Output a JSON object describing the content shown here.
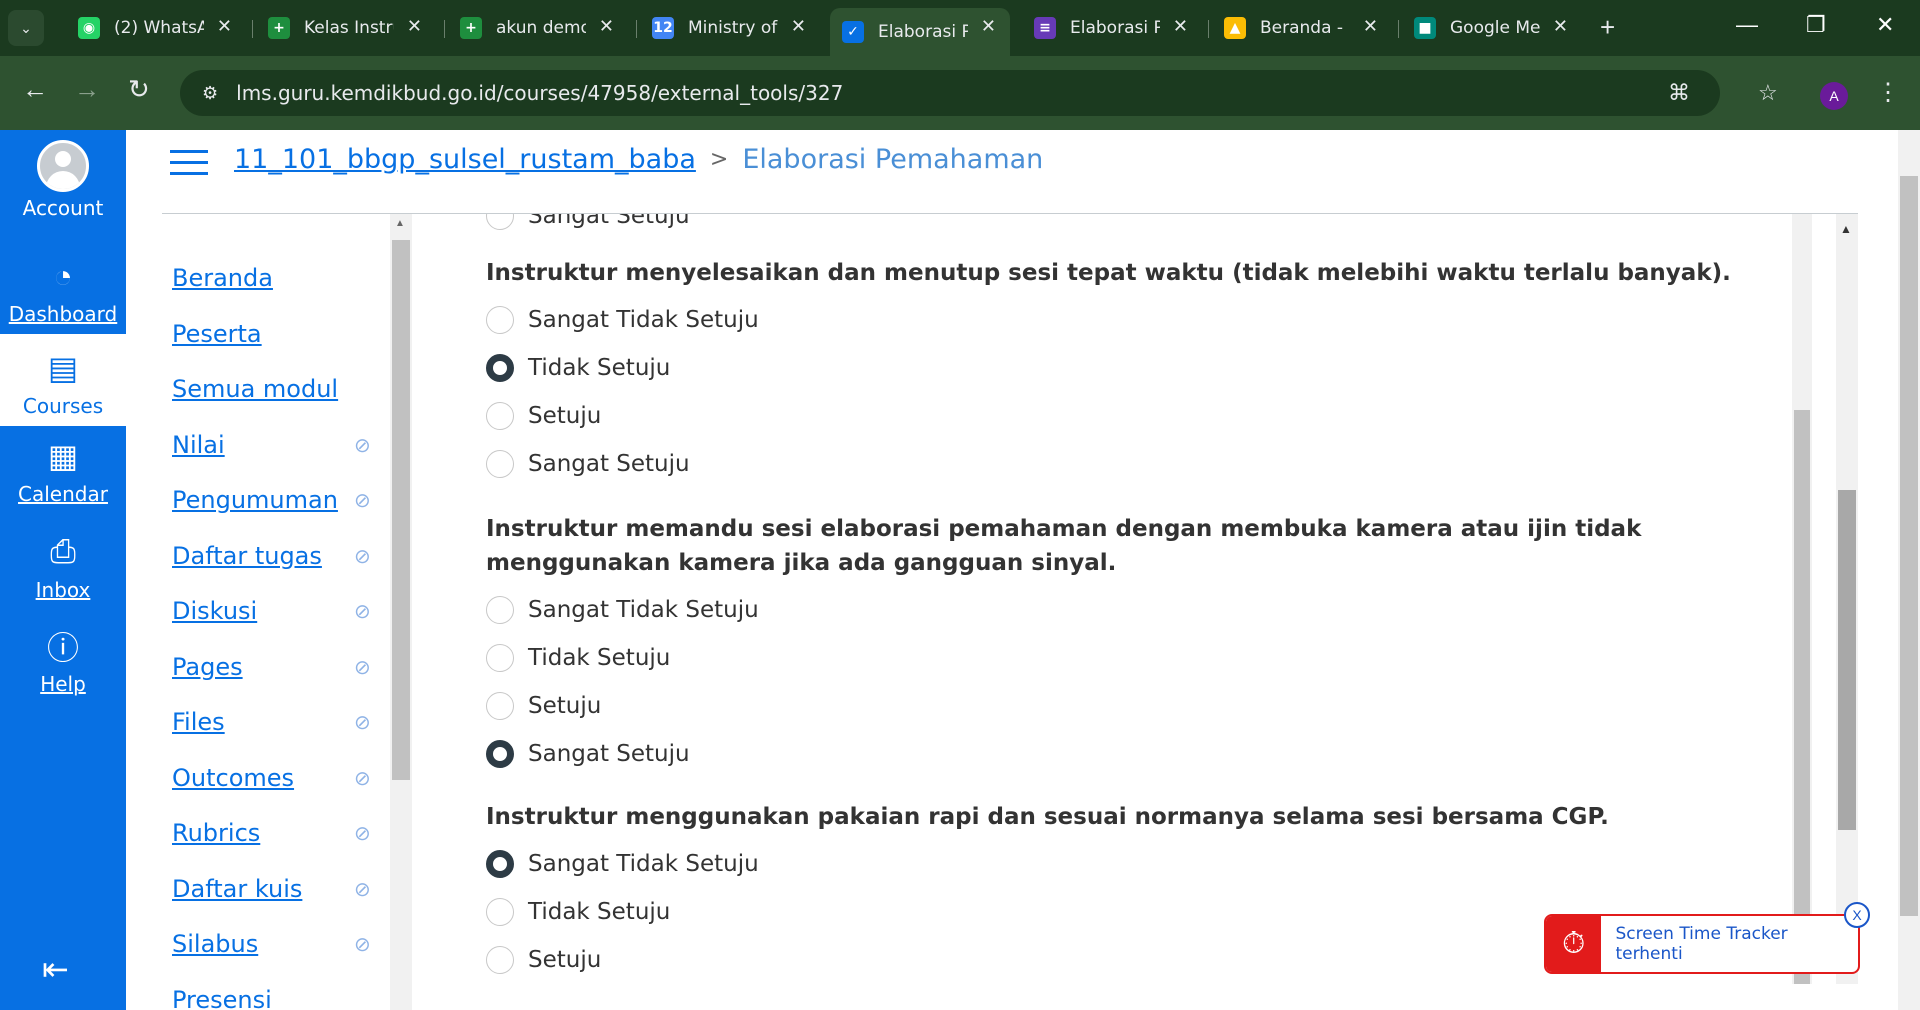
{
  "browser": {
    "tabs": [
      {
        "label": "(2) WhatsA",
        "icon": "whatsapp-icon",
        "color": "#25d366",
        "glyph": "◉"
      },
      {
        "label": "Kelas Instru",
        "icon": "sheets-icon",
        "color": "#1e8e3e",
        "glyph": "+"
      },
      {
        "label": "akun demo",
        "icon": "sheets-icon",
        "color": "#1e8e3e",
        "glyph": "+"
      },
      {
        "label": "Ministry of",
        "icon": "calendar-icon",
        "color": "#4285f4",
        "glyph": "12"
      },
      {
        "label": "Elaborasi P",
        "icon": "canvas-icon",
        "color": "#0770e3",
        "glyph": "✓"
      },
      {
        "label": "Elaborasi P",
        "icon": "forms-icon",
        "color": "#673ab7",
        "glyph": "≡"
      },
      {
        "label": "Beranda -",
        "icon": "drive-icon",
        "color": "#fbbc04",
        "glyph": "▲"
      },
      {
        "label": "Google Me",
        "icon": "meet-icon",
        "color": "#00897b",
        "glyph": "■"
      }
    ],
    "url": "lms.guru.kemdikbud.go.id/courses/47958/external_tools/327",
    "profile_initial": "A"
  },
  "globalnav": {
    "account": "Account",
    "dashboard": "Dashboard",
    "courses": "Courses",
    "calendar": "Calendar",
    "inbox": "Inbox",
    "help": "Help"
  },
  "breadcrumb": {
    "course": "11_101_bbgp_sulsel_rustam_baba",
    "page": "Elaborasi Pemahaman",
    "separator": ">"
  },
  "coursenav": {
    "items": [
      {
        "label": "Beranda",
        "hidden": false
      },
      {
        "label": "Peserta",
        "hidden": false
      },
      {
        "label": "Semua modul",
        "hidden": false
      },
      {
        "label": "Nilai",
        "hidden": true
      },
      {
        "label": "Pengumuman",
        "hidden": true
      },
      {
        "label": "Daftar tugas",
        "hidden": true
      },
      {
        "label": "Diskusi",
        "hidden": true
      },
      {
        "label": "Pages",
        "hidden": true
      },
      {
        "label": "Files",
        "hidden": true
      },
      {
        "label": "Outcomes",
        "hidden": true
      },
      {
        "label": "Rubrics",
        "hidden": true
      },
      {
        "label": "Daftar kuis",
        "hidden": true
      },
      {
        "label": "Silabus",
        "hidden": true
      },
      {
        "label": "Presensi",
        "hidden": false
      }
    ]
  },
  "survey": {
    "partial_option": "Sangat Setuju",
    "questions": [
      {
        "text": "Instruktur menyelesaikan dan menutup sesi tepat waktu (tidak melebihi waktu terlalu banyak).",
        "options": [
          "Sangat Tidak Setuju",
          "Tidak Setuju",
          "Setuju",
          "Sangat Setuju"
        ],
        "selected": 1
      },
      {
        "text": "Instruktur memandu sesi elaborasi pemahaman dengan membuka kamera atau ijin tidak menggunakan kamera jika ada gangguan sinyal.",
        "options": [
          "Sangat Tidak Setuju",
          "Tidak Setuju",
          "Setuju",
          "Sangat Setuju"
        ],
        "selected": 3
      },
      {
        "text": "Instruktur menggunakan pakaian rapi dan sesuai normanya selama sesi bersama CGP.",
        "options": [
          "Sangat Tidak Setuju",
          "Tidak Setuju",
          "Setuju"
        ],
        "selected": 0
      }
    ]
  },
  "tracker": {
    "text": "Screen Time Tracker terhenti",
    "close": "X"
  },
  "colors": {
    "canvas_blue": "#0770e3",
    "chrome_dark": "#1b3a1f",
    "chrome_toolbar": "#2e5230",
    "tracker_red": "#e21b1b"
  }
}
